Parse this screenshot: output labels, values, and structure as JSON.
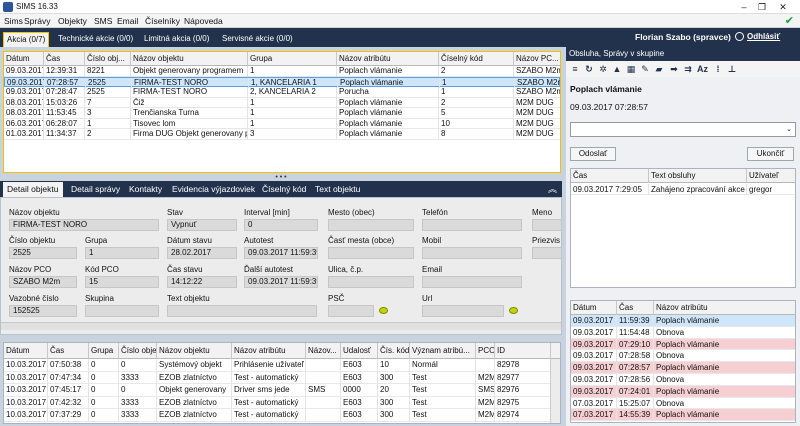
{
  "window": {
    "title": "SIMS 16.33"
  },
  "menu": [
    "Sims",
    "Správy",
    "Objekty",
    "SMS",
    "Email",
    "Číselníky",
    "Nápoveda"
  ],
  "tabs": [
    "Akcia (0/7)",
    "Technické akcie (0/0)",
    "Limitná akcia (0/0)",
    "Servisné akcie (0/0)"
  ],
  "user": {
    "name": "Florian Szabo (spravce)",
    "logout": "Odhlásiť"
  },
  "alarms": {
    "columns": [
      "Dátum",
      "Čas",
      "Číslo obj...",
      "Názov objektu",
      "Grupa",
      "Názov atribútu",
      "Číselný kód",
      "Názov PC..."
    ],
    "rows": [
      [
        "09.03.2017",
        "12:39:31",
        "8221",
        "Objekt generovany programem",
        "1",
        "Poplach vlámanie",
        "2",
        "SZABO M2m"
      ],
      [
        "09.03.2017",
        "07:28:57",
        "2525",
        "FIRMA-TEST NORO",
        "1, KANCELARIA 1",
        "Poplach vlámanie",
        "1",
        "SZABO M2m"
      ],
      [
        "09.03.2017",
        "07:28:47",
        "2525",
        "FIRMA-TEST NORO",
        "2, KANCELARIA 2",
        "Porucha",
        "1",
        "SZABO M2m"
      ],
      [
        "08.03.2017",
        "15:03:26",
        "7",
        "Čiž",
        "1",
        "Poplach vlámanie",
        "2",
        "M2M DUG"
      ],
      [
        "08.03.2017",
        "11:53:45",
        "3",
        "Trenčianska Turna",
        "1",
        "Poplach vlámanie",
        "5",
        "M2M DUG"
      ],
      [
        "06.03.2017",
        "06:28:07",
        "1",
        "Tisovec lom",
        "1",
        "Poplach vlámanie",
        "10",
        "M2M DUG"
      ],
      [
        "01.03.2017",
        "11:34:37",
        "2",
        "Firma DUG Objekt generovany p",
        "3",
        "Poplach vlámanie",
        "8",
        "M2M DUG"
      ]
    ]
  },
  "subtabs": [
    "Detail objektu",
    "Detail správy",
    "Kontakty",
    "Evidencia výjazdoviek",
    "Číselný kód",
    "Text objektu"
  ],
  "detail": {
    "nazov_objektu": {
      "label": "Názov objektu",
      "value": "FIRMA-TEST NORO"
    },
    "cislo_objektu": {
      "label": "Číslo objektu",
      "value": "2525"
    },
    "grupa": {
      "label": "Grupa",
      "value": "1"
    },
    "nazov_pco": {
      "label": "Názov PCO",
      "value": "SZABO M2m"
    },
    "kod_pco": {
      "label": "Kód PCO",
      "value": "15"
    },
    "vazobne": {
      "label": "Vazobné číslo",
      "value": "152525"
    },
    "skupina": {
      "label": "Skupina",
      "value": ""
    },
    "stav": {
      "label": "Stav",
      "value": "Vypnuť"
    },
    "datum_stavu": {
      "label": "Dátum stavu",
      "value": "28.02.2017"
    },
    "cas_stavu": {
      "label": "Čas stavu",
      "value": "14:12:22"
    },
    "text_objektu": {
      "label": "Text objektu",
      "value": ""
    },
    "interval": {
      "label": "Interval [min]",
      "value": "0"
    },
    "autotest": {
      "label": "Autotest",
      "value": "09.03.2017 11:59:39"
    },
    "dalsi_autotest": {
      "label": "Ďalší autotest",
      "value": "09.03.2017 11:59:39"
    },
    "mesto": {
      "label": "Mesto (obec)",
      "value": ""
    },
    "cast_mesta": {
      "label": "Časť mesta (obce)",
      "value": ""
    },
    "ulica": {
      "label": "Ulica, č.p.",
      "value": ""
    },
    "psc": {
      "label": "PSČ",
      "value": ""
    },
    "telefon": {
      "label": "Telefón",
      "value": ""
    },
    "mobil": {
      "label": "Mobil",
      "value": ""
    },
    "email": {
      "label": "Email",
      "value": ""
    },
    "url": {
      "label": "Url",
      "value": ""
    },
    "meno": {
      "label": "Meno",
      "value": ""
    },
    "priezvisko": {
      "label": "Priezvis",
      "value": ""
    }
  },
  "events": {
    "columns": [
      "Dátum",
      "Čas",
      "Grupa",
      "Číslo obje...",
      "Názov objektu",
      "Názov atribútu",
      "Názov...",
      "Udalosť",
      "Čís. kód",
      "Význam atribú...",
      "PCO",
      "ID"
    ],
    "rows": [
      [
        "10.03.2017",
        "07:50:38",
        "0",
        "0",
        "Systémový objekt",
        "Prihlásenie užívateľ",
        "",
        "E603",
        "10",
        "Normál",
        "",
        "82978"
      ],
      [
        "10.03.2017",
        "07:47:34",
        "0",
        "3333",
        "EZOB zlatníctvo",
        "Test - automatický",
        "",
        "E603",
        "300",
        "Test",
        "M2M",
        "82977"
      ],
      [
        "10.03.2017",
        "07:45:17",
        "0",
        "0",
        "Objekt generovany",
        "Driver sms jede",
        "SMS",
        "0000",
        "20",
        "Test",
        "SMS-",
        "82976"
      ],
      [
        "10.03.2017",
        "07:42:32",
        "0",
        "3333",
        "EZOB zlatníctvo",
        "Test - automatický",
        "",
        "E603",
        "300",
        "Test",
        "M2M",
        "82975"
      ],
      [
        "10.03.2017",
        "07:37:29",
        "0",
        "3333",
        "EZOB zlatníctvo",
        "Test - automatický",
        "",
        "E603",
        "300",
        "Test",
        "M2M",
        "82974"
      ]
    ]
  },
  "right": {
    "header": "Obsluha, Správy v skupine",
    "title": "Poplach vlámanie",
    "datetime": "09.03.2017 07:28:57",
    "send": "Odoslať",
    "finish": "Ukončiť",
    "service": {
      "columns": [
        "Čas",
        "Text obsluhy",
        "Užívateľ"
      ],
      "rows": [
        [
          "09.03.2017 7:29:05",
          "Zahájeno zpracování akce",
          "gregor"
        ]
      ]
    },
    "history": {
      "columns": [
        "Dátum",
        "Čas",
        "Názov atribútu"
      ],
      "rows": [
        [
          "09.03.2017",
          "11:59:39",
          "Poplach vlámanie",
          "blue"
        ],
        [
          "09.03.2017",
          "11:54:48",
          "Obnova",
          ""
        ],
        [
          "09.03.2017",
          "07:29:10",
          "Poplach vlámanie",
          "pink"
        ],
        [
          "09.03.2017",
          "07:28:58",
          "Obnova",
          ""
        ],
        [
          "09.03.2017",
          "07:28:57",
          "Poplach vlámanie",
          "pink"
        ],
        [
          "09.03.2017",
          "07:28:56",
          "Obnova",
          ""
        ],
        [
          "09.03.2017",
          "07:24:01",
          "Poplach vlámanie",
          "pink"
        ],
        [
          "07.03.2017",
          "15:25:07",
          "Obnova",
          ""
        ],
        [
          "07.03.2017",
          "14:55:39",
          "Poplach vlámanie",
          "pink"
        ]
      ]
    }
  },
  "colors": {
    "navy": "#22324c",
    "accent": "#f2c200",
    "selected": "#cfe6fa",
    "alarm": "#f6cfd2"
  }
}
